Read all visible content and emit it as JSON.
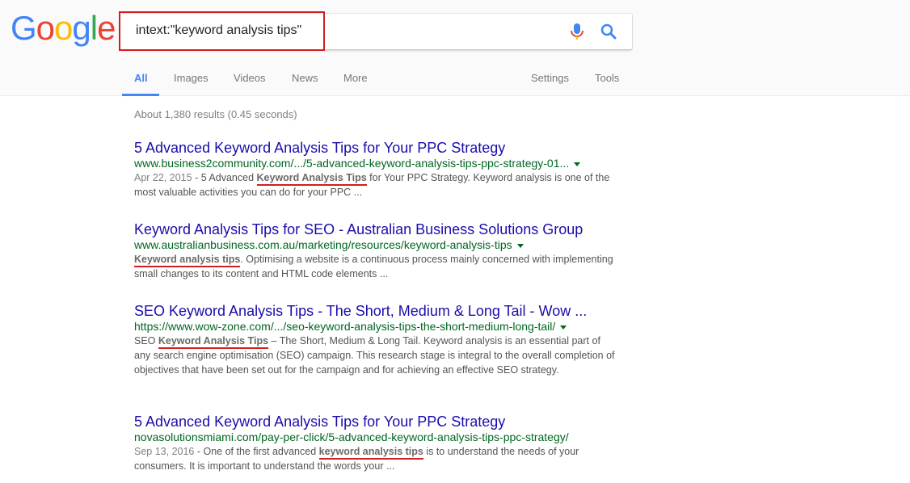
{
  "logo": {
    "letters": [
      "G",
      "o",
      "o",
      "g",
      "l",
      "e"
    ],
    "colors": [
      "#4285f4",
      "#ea4335",
      "#fbbc05",
      "#4285f4",
      "#34a853",
      "#ea4335"
    ]
  },
  "search": {
    "query": "intext:\"keyword analysis tips\"",
    "mic_icon": "microphone-icon",
    "search_icon": "magnifier-icon"
  },
  "tabs": {
    "all": "All",
    "images": "Images",
    "videos": "Videos",
    "news": "News",
    "more": "More",
    "settings": "Settings",
    "tools": "Tools"
  },
  "stats": "About 1,380 results (0.45 seconds)",
  "accent_color": "#4285f4",
  "highlight_underline_color": "#d21e1e",
  "results": [
    {
      "title": "5 Advanced Keyword Analysis Tips for Your PPC Strategy",
      "url": "www.business2community.com/.../5-advanced-keyword-analysis-tips-ppc-strategy-01...",
      "date": "Apr 22, 2015",
      "snippet_pre": " - 5 Advanced ",
      "snippet_hl": "Keyword Analysis Tips",
      "snippet_post": " for Your PPC Strategy. Keyword analysis is one of the most valuable activities you can do for your PPC ..."
    },
    {
      "title": "Keyword Analysis Tips for SEO - Australian Business Solutions Group",
      "url": "www.australianbusiness.com.au/marketing/resources/keyword-analysis-tips",
      "date": "",
      "snippet_pre": "",
      "snippet_hl": "Keyword analysis tips",
      "snippet_post": ". Optimising a website is a continuous process mainly concerned with implementing small changes to its content and HTML code elements ..."
    },
    {
      "title": "SEO Keyword Analysis Tips - The Short, Medium & Long Tail - Wow ...",
      "url": "https://www.wow-zone.com/.../seo-keyword-analysis-tips-the-short-medium-long-tail/",
      "date": "",
      "snippet_pre": "SEO ",
      "snippet_hl": "Keyword Analysis Tips",
      "snippet_post": " – The Short, Medium & Long Tail. Keyword analysis is an essential part of any search engine optimisation (SEO) campaign. This research stage is integral to the overall completion of objectives that have been set out for the campaign and for achieving an effective SEO strategy."
    },
    {
      "title": "5 Advanced Keyword Analysis Tips for Your PPC Strategy",
      "url": "novasolutionsmiami.com/pay-per-click/5-advanced-keyword-analysis-tips-ppc-strategy/",
      "date": "Sep 13, 2016",
      "snippet_pre": " - One of the first advanced ",
      "snippet_hl": "keyword analysis tips",
      "snippet_post": " is to understand the needs of your consumers. It is important to understand the words your ..."
    }
  ]
}
